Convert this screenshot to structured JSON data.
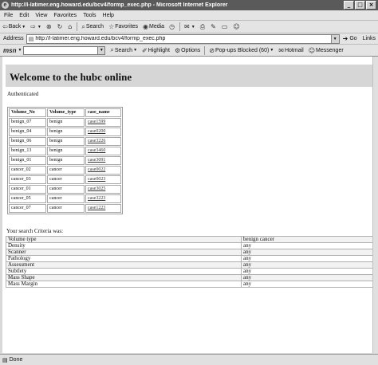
{
  "window": {
    "title": "http://l-latimer.eng.howard.edu/bcv4/formp_exec.php - Microsoft Internet Explorer",
    "minimize": "_",
    "maximize": "□",
    "close": "×"
  },
  "menubar": [
    "File",
    "Edit",
    "View",
    "Favorites",
    "Tools",
    "Help"
  ],
  "toolbar": {
    "back": "Back",
    "search": "Search",
    "favorites": "Favorites",
    "media": "Media"
  },
  "address": {
    "label": "Address",
    "url": "http://l-latimer.eng.howard.edu/bcv4/formp_exec.php",
    "go": "Go",
    "links": "Links"
  },
  "msnbar": {
    "logo": "msn",
    "search": "Search",
    "highlight": "Highlight",
    "options": "Options",
    "popups": "Pop-ups Blocked (60)",
    "hotmail": "Hotmail",
    "messenger": "Messenger"
  },
  "page": {
    "heading": "Welcome to the hubc online",
    "auth_text": "Authenticated",
    "table": {
      "headers": [
        "Volume_No",
        "Volume_type",
        "case_name"
      ],
      "rows": [
        [
          "benign_07",
          "benign",
          "case1599"
        ],
        [
          "benign_04",
          "benign",
          "case0200"
        ],
        [
          "benign_06",
          "benign",
          "case3226"
        ],
        [
          "benign_13",
          "benign",
          "case3460"
        ],
        [
          "benign_01",
          "benign",
          "case3091"
        ],
        [
          "cancer_02",
          "cancer",
          "case0022"
        ],
        [
          "cancer_03",
          "cancer",
          "case0023"
        ],
        [
          "cancer_01",
          "cancer",
          "case3025"
        ],
        [
          "cancer_05",
          "cancer",
          "case3223"
        ],
        [
          "cancer_07",
          "cancer",
          "case1223"
        ]
      ]
    },
    "criteria_label": "Your search Criteria was:",
    "criteria": [
      [
        "Volume type",
        "benign cancer"
      ],
      [
        "Density",
        "any"
      ],
      [
        "Scanner",
        "any"
      ],
      [
        "Pathology",
        "any"
      ],
      [
        "Assessment",
        "any"
      ],
      [
        "Subtlety",
        "any"
      ],
      [
        "Mass Shape",
        "any"
      ],
      [
        "Mass Margin",
        "any"
      ]
    ]
  },
  "status": {
    "text": "Done"
  }
}
